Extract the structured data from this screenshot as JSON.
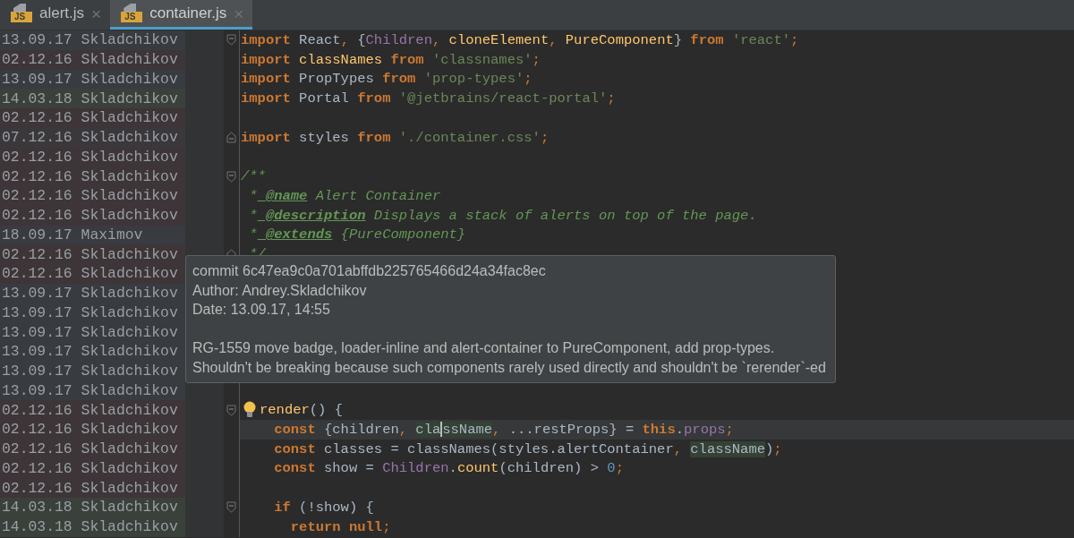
{
  "tabs": [
    {
      "label": "alert.js",
      "icon_text": "JS",
      "close_glyph": "×",
      "selected": false
    },
    {
      "label": "container.js",
      "icon_text": "JS",
      "close_glyph": "×",
      "selected": true
    }
  ],
  "annotations": [
    {
      "date": "13.09.17",
      "author": "Skladchikov",
      "color": "#383b40"
    },
    {
      "date": "02.12.16",
      "author": "Skladchikov",
      "color": "#3d3538"
    },
    {
      "date": "13.09.17",
      "author": "Skladchikov",
      "color": "#383b40"
    },
    {
      "date": "14.03.18",
      "author": "Skladchikov",
      "color": "#3a413b"
    },
    {
      "date": "02.12.16",
      "author": "Skladchikov",
      "color": "#3d3538"
    },
    {
      "date": "07.12.16",
      "author": "Skladchikov",
      "color": "#3b383c"
    },
    {
      "date": "02.12.16",
      "author": "Skladchikov",
      "color": "#3d3538"
    },
    {
      "date": "02.12.16",
      "author": "Skladchikov",
      "color": "#3d3538"
    },
    {
      "date": "02.12.16",
      "author": "Skladchikov",
      "color": "#3d3538"
    },
    {
      "date": "02.12.16",
      "author": "Skladchikov",
      "color": "#3d3538"
    },
    {
      "date": "18.09.17",
      "author": "Maximov",
      "color": "#383b40"
    },
    {
      "date": "02.12.16",
      "author": "Skladchikov",
      "color": "#3d3538"
    },
    {
      "date": "02.12.16",
      "author": "Skladchikov",
      "color": "#3d3538"
    },
    {
      "date": "13.09.17",
      "author": "Skladchikov",
      "color": "#383b40"
    },
    {
      "date": "13.09.17",
      "author": "Skladchikov",
      "color": "#383b40"
    },
    {
      "date": "13.09.17",
      "author": "Skladchikov",
      "color": "#383b40"
    },
    {
      "date": "13.09.17",
      "author": "Skladchikov",
      "color": "#383b40"
    },
    {
      "date": "13.09.17",
      "author": "Skladchikov",
      "color": "#383b40"
    },
    {
      "date": "13.09.17",
      "author": "Skladchikov",
      "color": "#383b40"
    },
    {
      "date": "02.12.16",
      "author": "Skladchikov",
      "color": "#3d3538"
    },
    {
      "date": "02.12.16",
      "author": "Skladchikov",
      "color": "#3d3538"
    },
    {
      "date": "02.12.16",
      "author": "Skladchikov",
      "color": "#3d3538"
    },
    {
      "date": "02.12.16",
      "author": "Skladchikov",
      "color": "#3d3538"
    },
    {
      "date": "02.12.16",
      "author": "Skladchikov",
      "color": "#3d3538"
    },
    {
      "date": "14.03.18",
      "author": "Skladchikov",
      "color": "#3a413b"
    },
    {
      "date": "14.03.18",
      "author": "Skladchikov",
      "color": "#3a413b"
    }
  ],
  "code_lines": [
    {
      "current": false,
      "fold": {
        "kind": "start"
      },
      "tokens": [
        {
          "kind": "kw",
          "text": "import"
        },
        {
          "kind": "id",
          "text": " React"
        },
        {
          "kind": "punct",
          "text": ","
        },
        {
          "kind": "id",
          "text": " {"
        },
        {
          "kind": "cls",
          "text": "Children"
        },
        {
          "kind": "punct",
          "text": ","
        },
        {
          "kind": "fn",
          "text": " cloneElement"
        },
        {
          "kind": "punct",
          "text": ","
        },
        {
          "kind": "fn",
          "text": " PureComponent"
        },
        {
          "kind": "id",
          "text": "}"
        },
        {
          "kind": "kw",
          "text": " from"
        },
        {
          "kind": "str",
          "text": " 'react'"
        },
        {
          "kind": "punct",
          "text": ";"
        }
      ]
    },
    {
      "current": false,
      "tokens": [
        {
          "kind": "kw",
          "text": "import"
        },
        {
          "kind": "fn",
          "text": " classNames"
        },
        {
          "kind": "kw",
          "text": " from"
        },
        {
          "kind": "str",
          "text": " 'classnames'"
        },
        {
          "kind": "punct",
          "text": ";"
        }
      ]
    },
    {
      "current": false,
      "tokens": [
        {
          "kind": "kw",
          "text": "import"
        },
        {
          "kind": "id",
          "text": " PropTypes"
        },
        {
          "kind": "kw",
          "text": " from"
        },
        {
          "kind": "str",
          "text": " 'prop-types'"
        },
        {
          "kind": "punct",
          "text": ";"
        }
      ]
    },
    {
      "current": false,
      "tokens": [
        {
          "kind": "kw",
          "text": "import"
        },
        {
          "kind": "id",
          "text": " Portal"
        },
        {
          "kind": "kw",
          "text": " from"
        },
        {
          "kind": "str",
          "text": " '@jetbrains/react-portal'"
        },
        {
          "kind": "punct",
          "text": ";"
        }
      ]
    },
    {
      "current": false
    },
    {
      "current": false,
      "fold": {
        "kind": "end"
      },
      "tokens": [
        {
          "kind": "kw",
          "text": "import"
        },
        {
          "kind": "id",
          "text": " styles"
        },
        {
          "kind": "kw",
          "text": " from"
        },
        {
          "kind": "str",
          "text": " './container.css'"
        },
        {
          "kind": "punct",
          "text": ";"
        }
      ]
    },
    {
      "current": false
    },
    {
      "current": false,
      "fold": {
        "kind": "start"
      },
      "tokens": [
        {
          "kind": "doc",
          "text": "/**"
        }
      ]
    },
    {
      "current": false,
      "tokens": [
        {
          "kind": "doc",
          "text": " *"
        },
        {
          "kind": "tag",
          "text": " @name"
        },
        {
          "kind": "doc",
          "text": " Alert Container"
        }
      ]
    },
    {
      "current": false,
      "tokens": [
        {
          "kind": "doc",
          "text": " *"
        },
        {
          "kind": "tag",
          "text": " @description"
        },
        {
          "kind": "doc",
          "text": " Displays a stack of alerts on top of the page."
        }
      ]
    },
    {
      "current": false,
      "tokens": [
        {
          "kind": "doc",
          "text": " *"
        },
        {
          "kind": "tag",
          "text": " @extends"
        },
        {
          "kind": "doc",
          "text": " {PureComponent}"
        }
      ]
    },
    {
      "current": false,
      "fold": {
        "kind": "end"
      },
      "tokens": [
        {
          "kind": "doc",
          "text": " */"
        }
      ]
    },
    {
      "current": false
    },
    {
      "current": false
    },
    {
      "current": false
    },
    {
      "current": false
    },
    {
      "current": false
    },
    {
      "current": false
    },
    {
      "current": false
    },
    {
      "current": false,
      "fold": {
        "kind": "start"
      },
      "bulb": true,
      "tokens": [
        {
          "kind": "fn",
          "text": "render"
        },
        {
          "kind": "id",
          "text": "() {"
        }
      ]
    },
    {
      "current": true,
      "tokens": [
        {
          "kind": "kw",
          "text": "    const"
        },
        {
          "kind": "id",
          "text": " {children"
        },
        {
          "kind": "punct",
          "text": ","
        },
        {
          "kind": "hl",
          "text": " cla"
        },
        {
          "kind": "caret"
        },
        {
          "kind": "hl",
          "text": "ssName"
        },
        {
          "kind": "punct",
          "text": ","
        },
        {
          "kind": "id",
          "text": " ...restProps} ="
        },
        {
          "kind": "kw",
          "text": " this"
        },
        {
          "kind": "id",
          "text": "."
        },
        {
          "kind": "prop",
          "text": "props"
        },
        {
          "kind": "punct",
          "text": ";"
        }
      ]
    },
    {
      "current": false,
      "tokens": [
        {
          "kind": "kw",
          "text": "    const"
        },
        {
          "kind": "id",
          "text": " classes = classNames(styles.alertContainer"
        },
        {
          "kind": "punct",
          "text": ","
        },
        {
          "kind": "hl",
          "text": " className"
        },
        {
          "kind": "id",
          "text": ")"
        },
        {
          "kind": "punct",
          "text": ";"
        }
      ]
    },
    {
      "current": false,
      "tokens": [
        {
          "kind": "kw",
          "text": "    const"
        },
        {
          "kind": "id",
          "text": " show ="
        },
        {
          "kind": "cls",
          "text": " Children"
        },
        {
          "kind": "id",
          "text": "."
        },
        {
          "kind": "fn",
          "text": "count"
        },
        {
          "kind": "id",
          "text": "(children) >"
        },
        {
          "kind": "num",
          "text": " 0"
        },
        {
          "kind": "punct",
          "text": ";"
        }
      ]
    },
    {
      "current": false
    },
    {
      "current": false,
      "fold": {
        "kind": "start"
      },
      "tokens": [
        {
          "kind": "kw",
          "text": "    if"
        },
        {
          "kind": "id",
          "text": " (!show) {"
        }
      ]
    },
    {
      "current": false,
      "tokens": [
        {
          "kind": "kw",
          "text": "      return"
        },
        {
          "kind": "kw",
          "text": " null"
        },
        {
          "kind": "punct",
          "text": ";"
        }
      ]
    }
  ],
  "tooltip": {
    "header": [
      "commit 6c47ea9c0a701abffdb225765466d24a34fac8ec",
      "Author: Andrey.Skladchikov",
      "Date: 13.09.17, 14:55"
    ],
    "message": [
      "RG-1559 move badge, loader-inline and alert-container to PureComponent, add prop-types.",
      "Shouldn't be breaking because such components rarely used directly and shouldn't be `rerender`-ed"
    ]
  }
}
